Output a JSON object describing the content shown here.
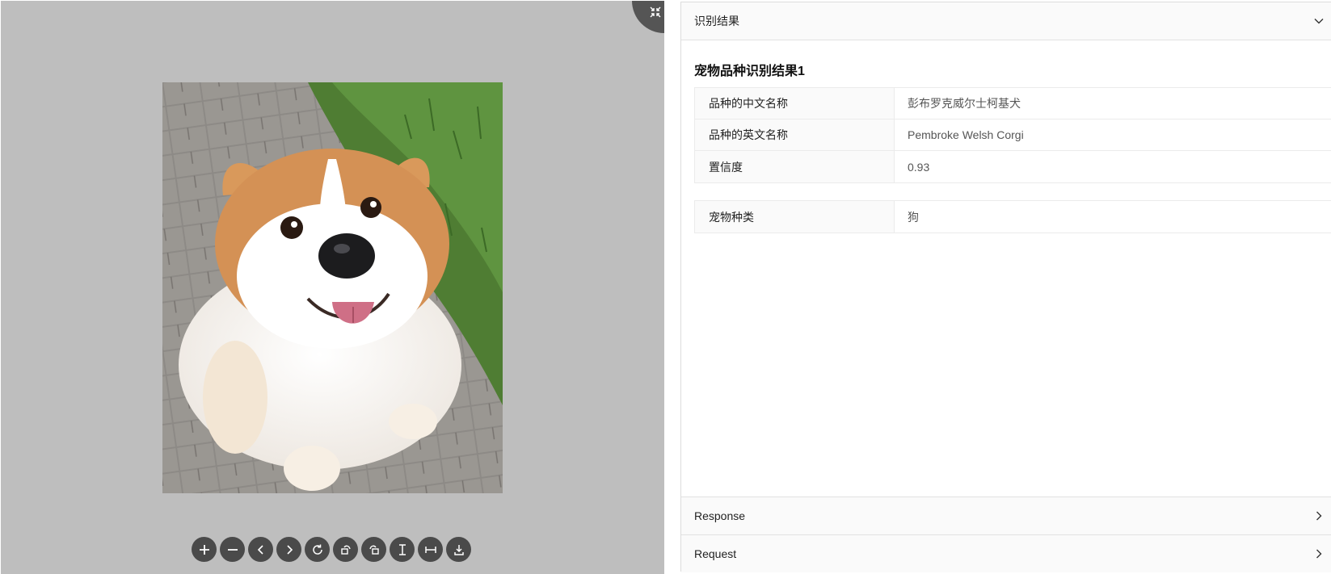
{
  "viewer": {
    "fullscreen_icon": "exit-fullscreen-icon",
    "toolbar": [
      {
        "name": "zoom-in-button",
        "icon": "plus-icon"
      },
      {
        "name": "zoom-out-button",
        "icon": "minus-icon"
      },
      {
        "name": "prev-button",
        "icon": "chevron-left-icon"
      },
      {
        "name": "next-button",
        "icon": "chevron-right-icon"
      },
      {
        "name": "reset-button",
        "icon": "refresh-icon"
      },
      {
        "name": "rotate-left-button",
        "icon": "rotate-left-icon"
      },
      {
        "name": "rotate-right-button",
        "icon": "rotate-right-icon"
      },
      {
        "name": "flip-vertical-button",
        "icon": "flip-vertical-icon"
      },
      {
        "name": "flip-horizontal-button",
        "icon": "flip-horizontal-icon"
      },
      {
        "name": "download-button",
        "icon": "download-icon"
      }
    ]
  },
  "panel": {
    "result_header": "识别结果",
    "section_title": "宠物品种识别结果1",
    "breed": {
      "cn_name_label": "品种的中文名称",
      "cn_name_value": "彭布罗克威尔士柯基犬",
      "en_name_label": "品种的英文名称",
      "en_name_value": "Pembroke Welsh Corgi",
      "confidence_label": "置信度",
      "confidence_value": "0.93"
    },
    "pet": {
      "type_label": "宠物种类",
      "type_value": "狗"
    },
    "response_label": "Response",
    "request_label": "Request"
  }
}
